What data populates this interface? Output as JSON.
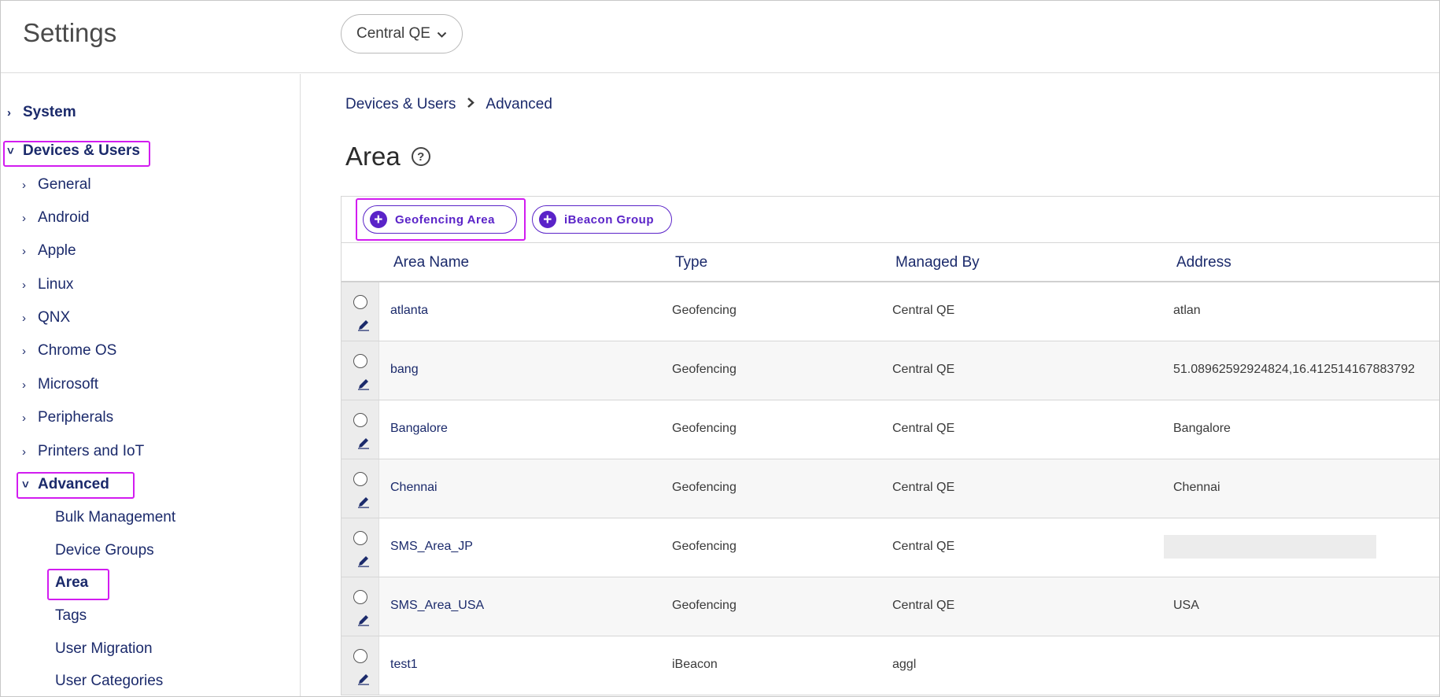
{
  "header": {
    "app_title": "Settings",
    "account_selector": "Central QE"
  },
  "sidebar": {
    "items": [
      {
        "label": "System"
      },
      {
        "label": "Devices & Users"
      },
      {
        "label": "General"
      },
      {
        "label": "Android"
      },
      {
        "label": "Apple"
      },
      {
        "label": "Linux"
      },
      {
        "label": "QNX"
      },
      {
        "label": "Chrome OS"
      },
      {
        "label": "Microsoft"
      },
      {
        "label": "Peripherals"
      },
      {
        "label": "Printers and IoT"
      },
      {
        "label": "Advanced"
      },
      {
        "label": "Bulk Management"
      },
      {
        "label": "Device Groups"
      },
      {
        "label": "Area"
      },
      {
        "label": "Tags"
      },
      {
        "label": "User Migration"
      },
      {
        "label": "User Categories"
      }
    ]
  },
  "breadcrumb": {
    "items": [
      "Devices & Users",
      "Advanced"
    ]
  },
  "page": {
    "title": "Area",
    "help_icon": "?"
  },
  "toolbar": {
    "geofencing_label": "Geofencing Area",
    "ibeacon_label": "iBeacon Group"
  },
  "table": {
    "columns": [
      "Area Name",
      "Type",
      "Managed By",
      "Address"
    ],
    "rows": [
      {
        "name": "atlanta",
        "type": "Geofencing",
        "managed_by": "Central QE",
        "address": "atlan"
      },
      {
        "name": "bang",
        "type": "Geofencing",
        "managed_by": "Central QE",
        "address": "51.08962592924824,16.412514167883792"
      },
      {
        "name": "Bangalore",
        "type": "Geofencing",
        "managed_by": "Central QE",
        "address": "Bangalore"
      },
      {
        "name": "Chennai",
        "type": "Geofencing",
        "managed_by": "Central QE",
        "address": "Chennai"
      },
      {
        "name": "SMS_Area_JP",
        "type": "Geofencing",
        "managed_by": "Central QE",
        "address": ""
      },
      {
        "name": "SMS_Area_USA",
        "type": "Geofencing",
        "managed_by": "Central QE",
        "address": "USA"
      },
      {
        "name": "test1",
        "type": "iBeacon",
        "managed_by": "aggl",
        "address": ""
      }
    ]
  },
  "colors": {
    "nav_text": "#1b2a6b",
    "accent": "#5a23c8",
    "highlight": "#d21cf0"
  }
}
